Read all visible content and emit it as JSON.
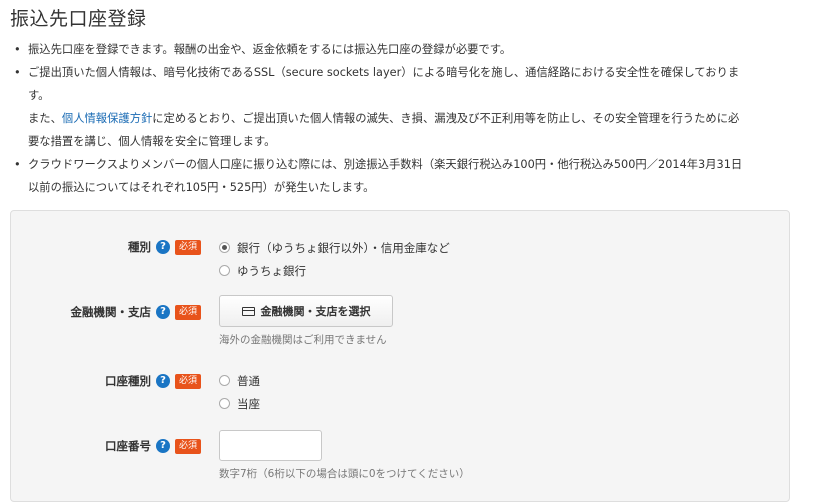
{
  "page": {
    "title": "振込先口座登録"
  },
  "notes": {
    "item1": "振込先口座を登録できます。報酬の出金や、返金依頼をするには振込先口座の登録が必要です。",
    "item2_line1": "ご提出頂いた個人情報は、暗号化技術であるSSL（secure sockets layer）による暗号化を施し、通信経路における安全性を確保しておりま",
    "item2_line2": "す。",
    "item2_line3_prefix": "また、",
    "item2_link": "個人情報保護方針",
    "item2_line3_suffix": "に定めるとおり、ご提出頂いた個人情報の滅失、き損、漏洩及び不正利用等を防止し、その安全管理を行うために必",
    "item2_line4": "要な措置を講じ、個人情報を安全に管理します。",
    "item3_line1": "クラウドワークスよりメンバーの個人口座に振り込む際には、別途振込手数料（楽天銀行税込み100円・他行税込み500円／2014年3月31日",
    "item3_line2": "以前の振込についてはそれぞれ105円・525円）が発生いたします。"
  },
  "form": {
    "help_glyph": "?",
    "required_badge": "必須",
    "type": {
      "label": "種別",
      "options": [
        "銀行（ゆうちょ銀行以外）・信用金庫など",
        "ゆうちょ銀行"
      ],
      "selected_index": 0
    },
    "bank": {
      "label": "金融機関・支店",
      "button_label": "金融機関・支店を選択",
      "button_icon": "card-icon",
      "hint": "海外の金融機関はご利用できません"
    },
    "account_type": {
      "label": "口座種別",
      "options": [
        "普通",
        "当座"
      ],
      "selected_index": null
    },
    "account_number": {
      "label": "口座番号",
      "value": "",
      "hint": "数字7桁（6桁以下の場合は頭に0をつけてください）"
    }
  },
  "colors": {
    "help_icon": "#1a75c4",
    "required_badge": "#e8531b",
    "link": "#1a6bb4",
    "panel_bg": "#f5f5f5"
  }
}
